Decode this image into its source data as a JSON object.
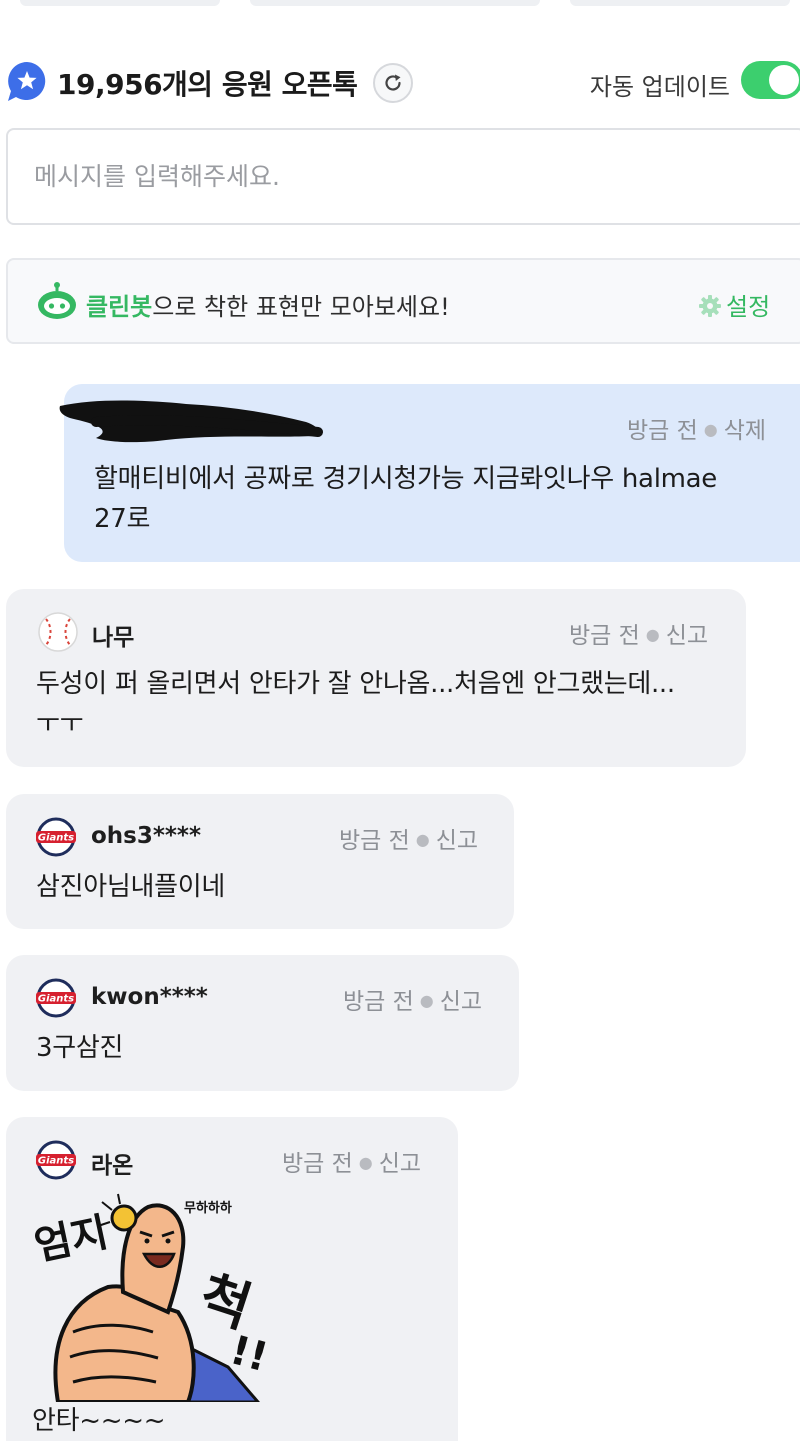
{
  "header": {
    "title": "19,956개의 응원 오픈톡",
    "auto_update_label": "자동 업데이트",
    "auto_update_on": true
  },
  "input": {
    "placeholder": "메시지를 입력해주세요."
  },
  "banner": {
    "highlight": "클린봇",
    "rest": "으로 착한 표현만 모아보세요!",
    "settings_label": "설정"
  },
  "messages": [
    {
      "mine": true,
      "nickname": "",
      "time": "방금 전",
      "action": "삭제",
      "text_line1": "할매티비에서 공짜로 경기시청가능 지금롸잇나우 halmae",
      "text_line2": "27로"
    },
    {
      "mine": false,
      "avatar": "baseball-icon",
      "nickname": "나무",
      "time": "방금 전",
      "action": "신고",
      "text_line1": "두성이 퍼 올리면서 안타가 잘 안나옴...처음엔 안그랬는데...",
      "text_line2": "ㅜㅜ"
    },
    {
      "mine": false,
      "avatar": "giants-logo-icon",
      "nickname": "ohs3****",
      "time": "방금 전",
      "action": "신고",
      "text_line1": "삼진아님내플이네"
    },
    {
      "mine": false,
      "avatar": "giants-logo-icon",
      "nickname": "kwon****",
      "time": "방금 전",
      "action": "신고",
      "text_line1": "3구삼진"
    },
    {
      "mine": false,
      "avatar": "giants-logo-icon",
      "nickname": "라온",
      "time": "방금 전",
      "action": "신고",
      "sticker": {
        "big_text_1": "엄지",
        "big_text_2": "척",
        "small_text": "무하하하"
      },
      "text_line1": "안타~~~~"
    }
  ],
  "colors": {
    "accent_green": "#35b862",
    "toggle_green": "#3ccf6e",
    "mine_bubble": "#dde9fb",
    "other_bubble": "#f0f1f4",
    "badge_blue": "#3d6ee8"
  }
}
